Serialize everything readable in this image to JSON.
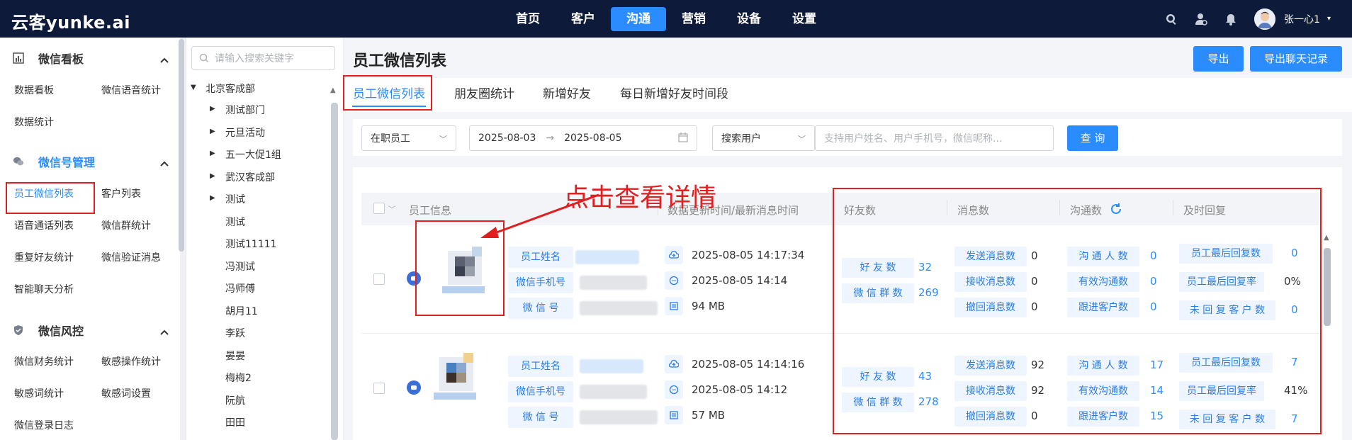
{
  "brand": {
    "logo": "云客yunke.ai"
  },
  "top_nav": [
    "首页",
    "客户",
    "沟通",
    "营销",
    "设备",
    "设置"
  ],
  "top_nav_active": "沟通",
  "user": {
    "name": "张一心1"
  },
  "sidebar": {
    "sections": [
      {
        "title": "微信看板",
        "items": [
          "数据看板",
          "微信语音统计",
          "数据统计"
        ]
      },
      {
        "title": "微信号管理",
        "items": [
          "员工微信列表",
          "客户列表",
          "语音通话列表",
          "微信群统计",
          "重复好友统计",
          "微信验证消息",
          "智能聊天分析"
        ]
      },
      {
        "title": "微信风控",
        "items": [
          "微信财务统计",
          "敏感操作统计",
          "敏感词统计",
          "敏感词设置",
          "微信登录日志"
        ]
      }
    ],
    "active_item": "员工微信列表"
  },
  "tree": {
    "search_placeholder": "请输入搜索关键字",
    "root": "北京客成部",
    "children": [
      {
        "label": "测试部门",
        "expandable": true
      },
      {
        "label": "元旦活动",
        "expandable": true
      },
      {
        "label": "五一大促1组",
        "expandable": true
      },
      {
        "label": "武汉客成部",
        "expandable": true
      },
      {
        "label": "测试",
        "expandable": true
      },
      {
        "label": "测试",
        "expandable": false
      },
      {
        "label": "测试11111",
        "expandable": false
      },
      {
        "label": "冯测试",
        "expandable": false
      },
      {
        "label": "冯师傅",
        "expandable": false
      },
      {
        "label": "胡月11",
        "expandable": false
      },
      {
        "label": "李跃",
        "expandable": false
      },
      {
        "label": "晏晏",
        "expandable": false
      },
      {
        "label": "梅梅2",
        "expandable": false
      },
      {
        "label": "阮航",
        "expandable": false
      },
      {
        "label": "田田",
        "expandable": false
      }
    ]
  },
  "page": {
    "title": "员工微信列表",
    "export_label": "导出",
    "export_chat_label": "导出聊天记录",
    "tabs": [
      "员工微信列表",
      "朋友圈统计",
      "新增好友",
      "每日新增好友时间段"
    ],
    "active_tab": "员工微信列表"
  },
  "filters": {
    "status": "在职员工",
    "date_start": "2025-08-03",
    "date_end": "2025-08-05",
    "date_arrow": "→",
    "search_type": "搜索用户",
    "search_placeholder": "支持用户姓名、用户手机号，微信昵称...",
    "query_label": "查 询"
  },
  "table": {
    "headers": [
      "员工信息",
      "数据更新时间/最新消息时间",
      "好友数",
      "消息数",
      "沟通数",
      "及时回复"
    ],
    "labels": {
      "name": "员工姓名",
      "phone": "微信手机号",
      "wechat": "微 信 号",
      "friends": "好 友 数",
      "groups": "微 信 群 数",
      "sent": "发送消息数",
      "received": "接收消息数",
      "recalled": "撤回消息数",
      "contacts": "沟 通 人 数",
      "effective": "有效沟通数",
      "followup": "跟进客户数",
      "last_reply": "员工最后回复数",
      "last_reply_rate": "员工最后回复率",
      "unreplied": "未 回 复 客 户 数"
    },
    "rows": [
      {
        "update_time": "2025-08-05 14:17:34",
        "last_msg_time": "2025-08-05 14:14",
        "storage": "94 MB",
        "friends": "32",
        "groups": "269",
        "sent": "0",
        "received": "0",
        "recalled": "0",
        "contacts": "0",
        "effective": "0",
        "followup": "0",
        "last_reply": "0",
        "last_reply_rate": "0%",
        "unreplied": "0"
      },
      {
        "update_time": "2025-08-05 14:14:16",
        "last_msg_time": "2025-08-05 14:12",
        "storage": "57 MB",
        "friends": "43",
        "groups": "278",
        "sent": "92",
        "received": "92",
        "recalled": "0",
        "contacts": "17",
        "effective": "14",
        "followup": "15",
        "last_reply": "7",
        "last_reply_rate": "41%",
        "unreplied": "7"
      }
    ]
  },
  "annotation": {
    "text": "点击查看详情",
    "color": "#e02020"
  },
  "colors": {
    "topbar": "#0d1a3a",
    "accent": "#2a8cff",
    "annotation": "#e02020"
  }
}
